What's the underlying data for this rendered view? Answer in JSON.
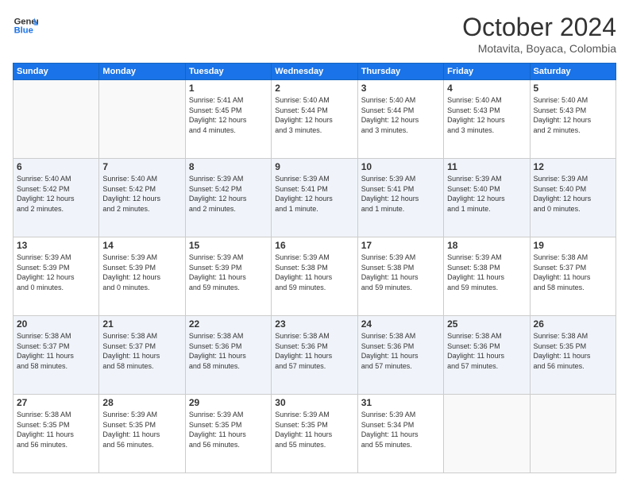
{
  "logo": {
    "line1": "General",
    "line2": "Blue"
  },
  "title": "October 2024",
  "location": "Motavita, Boyaca, Colombia",
  "days_of_week": [
    "Sunday",
    "Monday",
    "Tuesday",
    "Wednesday",
    "Thursday",
    "Friday",
    "Saturday"
  ],
  "weeks": [
    [
      {
        "day": "",
        "info": ""
      },
      {
        "day": "",
        "info": ""
      },
      {
        "day": "1",
        "info": "Sunrise: 5:41 AM\nSunset: 5:45 PM\nDaylight: 12 hours\nand 4 minutes."
      },
      {
        "day": "2",
        "info": "Sunrise: 5:40 AM\nSunset: 5:44 PM\nDaylight: 12 hours\nand 3 minutes."
      },
      {
        "day": "3",
        "info": "Sunrise: 5:40 AM\nSunset: 5:44 PM\nDaylight: 12 hours\nand 3 minutes."
      },
      {
        "day": "4",
        "info": "Sunrise: 5:40 AM\nSunset: 5:43 PM\nDaylight: 12 hours\nand 3 minutes."
      },
      {
        "day": "5",
        "info": "Sunrise: 5:40 AM\nSunset: 5:43 PM\nDaylight: 12 hours\nand 2 minutes."
      }
    ],
    [
      {
        "day": "6",
        "info": "Sunrise: 5:40 AM\nSunset: 5:42 PM\nDaylight: 12 hours\nand 2 minutes."
      },
      {
        "day": "7",
        "info": "Sunrise: 5:40 AM\nSunset: 5:42 PM\nDaylight: 12 hours\nand 2 minutes."
      },
      {
        "day": "8",
        "info": "Sunrise: 5:39 AM\nSunset: 5:42 PM\nDaylight: 12 hours\nand 2 minutes."
      },
      {
        "day": "9",
        "info": "Sunrise: 5:39 AM\nSunset: 5:41 PM\nDaylight: 12 hours\nand 1 minute."
      },
      {
        "day": "10",
        "info": "Sunrise: 5:39 AM\nSunset: 5:41 PM\nDaylight: 12 hours\nand 1 minute."
      },
      {
        "day": "11",
        "info": "Sunrise: 5:39 AM\nSunset: 5:40 PM\nDaylight: 12 hours\nand 1 minute."
      },
      {
        "day": "12",
        "info": "Sunrise: 5:39 AM\nSunset: 5:40 PM\nDaylight: 12 hours\nand 0 minutes."
      }
    ],
    [
      {
        "day": "13",
        "info": "Sunrise: 5:39 AM\nSunset: 5:39 PM\nDaylight: 12 hours\nand 0 minutes."
      },
      {
        "day": "14",
        "info": "Sunrise: 5:39 AM\nSunset: 5:39 PM\nDaylight: 12 hours\nand 0 minutes."
      },
      {
        "day": "15",
        "info": "Sunrise: 5:39 AM\nSunset: 5:39 PM\nDaylight: 11 hours\nand 59 minutes."
      },
      {
        "day": "16",
        "info": "Sunrise: 5:39 AM\nSunset: 5:38 PM\nDaylight: 11 hours\nand 59 minutes."
      },
      {
        "day": "17",
        "info": "Sunrise: 5:39 AM\nSunset: 5:38 PM\nDaylight: 11 hours\nand 59 minutes."
      },
      {
        "day": "18",
        "info": "Sunrise: 5:39 AM\nSunset: 5:38 PM\nDaylight: 11 hours\nand 59 minutes."
      },
      {
        "day": "19",
        "info": "Sunrise: 5:38 AM\nSunset: 5:37 PM\nDaylight: 11 hours\nand 58 minutes."
      }
    ],
    [
      {
        "day": "20",
        "info": "Sunrise: 5:38 AM\nSunset: 5:37 PM\nDaylight: 11 hours\nand 58 minutes."
      },
      {
        "day": "21",
        "info": "Sunrise: 5:38 AM\nSunset: 5:37 PM\nDaylight: 11 hours\nand 58 minutes."
      },
      {
        "day": "22",
        "info": "Sunrise: 5:38 AM\nSunset: 5:36 PM\nDaylight: 11 hours\nand 58 minutes."
      },
      {
        "day": "23",
        "info": "Sunrise: 5:38 AM\nSunset: 5:36 PM\nDaylight: 11 hours\nand 57 minutes."
      },
      {
        "day": "24",
        "info": "Sunrise: 5:38 AM\nSunset: 5:36 PM\nDaylight: 11 hours\nand 57 minutes."
      },
      {
        "day": "25",
        "info": "Sunrise: 5:38 AM\nSunset: 5:36 PM\nDaylight: 11 hours\nand 57 minutes."
      },
      {
        "day": "26",
        "info": "Sunrise: 5:38 AM\nSunset: 5:35 PM\nDaylight: 11 hours\nand 56 minutes."
      }
    ],
    [
      {
        "day": "27",
        "info": "Sunrise: 5:38 AM\nSunset: 5:35 PM\nDaylight: 11 hours\nand 56 minutes."
      },
      {
        "day": "28",
        "info": "Sunrise: 5:39 AM\nSunset: 5:35 PM\nDaylight: 11 hours\nand 56 minutes."
      },
      {
        "day": "29",
        "info": "Sunrise: 5:39 AM\nSunset: 5:35 PM\nDaylight: 11 hours\nand 56 minutes."
      },
      {
        "day": "30",
        "info": "Sunrise: 5:39 AM\nSunset: 5:35 PM\nDaylight: 11 hours\nand 55 minutes."
      },
      {
        "day": "31",
        "info": "Sunrise: 5:39 AM\nSunset: 5:34 PM\nDaylight: 11 hours\nand 55 minutes."
      },
      {
        "day": "",
        "info": ""
      },
      {
        "day": "",
        "info": ""
      }
    ]
  ]
}
